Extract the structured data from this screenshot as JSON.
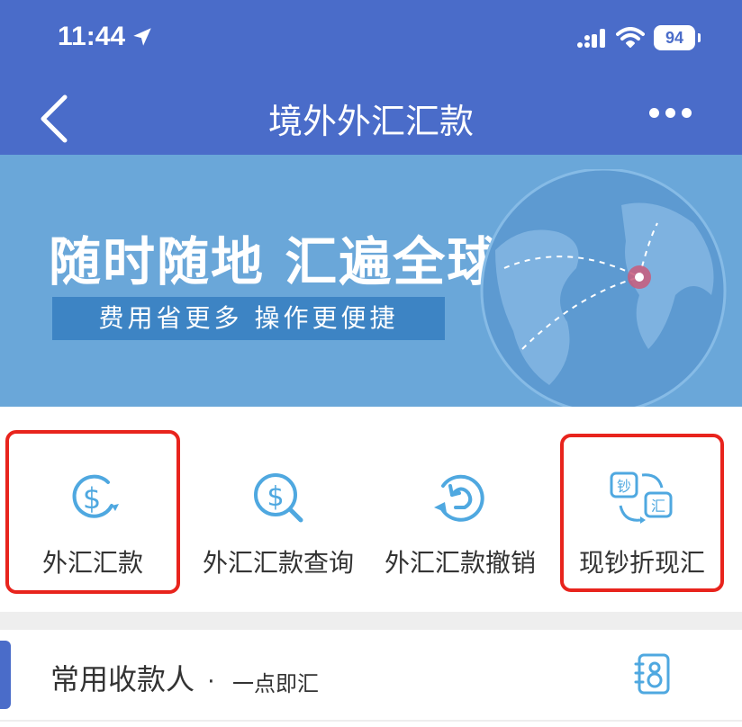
{
  "status": {
    "time": "11:44",
    "battery": "94"
  },
  "header": {
    "title": "境外外汇汇款"
  },
  "banner": {
    "title": "随时随地 汇遍全球",
    "subtitle": "费用省更多  操作更便捷"
  },
  "features": [
    {
      "label": "外汇汇款",
      "icon": "dollar-arrow-icon",
      "highlighted": true
    },
    {
      "label": "外汇汇款查询",
      "icon": "dollar-search-icon",
      "highlighted": false
    },
    {
      "label": "外汇汇款撤销",
      "icon": "dollar-undo-icon",
      "highlighted": false
    },
    {
      "label": "现钞折现汇",
      "icon": "cash-exchange-icon",
      "highlighted": true
    }
  ],
  "contacts": {
    "title": "常用收款人",
    "separator": "·",
    "subtitle": "一点即汇",
    "icon": "address-book-icon"
  },
  "colors": {
    "primary": "#4a6cc9",
    "banner": "#6aa7d9",
    "icon": "#4fa8e0",
    "highlight": "#e8241d"
  }
}
